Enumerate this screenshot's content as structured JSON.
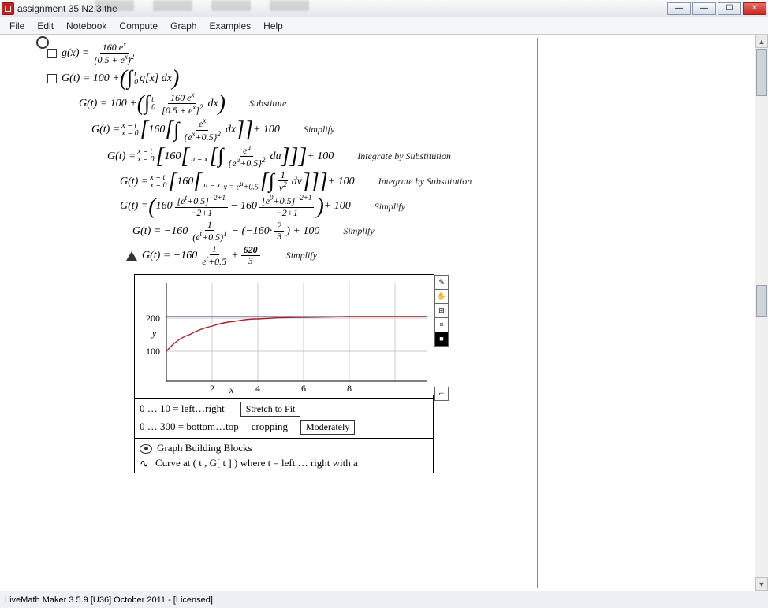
{
  "title": "assignment 35 N2.3.the",
  "menu": {
    "file": "File",
    "edit": "Edit",
    "notebook": "Notebook",
    "compute": "Compute",
    "graph": "Graph",
    "examples": "Examples",
    "help": "Help"
  },
  "eq1": "g(x) = 160 eˣ / (0.5 + eˣ)²",
  "eq2": "G(t) = 100 + ∫₀ᵗ g[x] dx",
  "eq3": "G(t) = 100 + ∫₀ᵗ 160 eˣ / [0.5 + eˣ]² dx",
  "eq4": "G(t) = {x=0..t} 160[ ∫ eˣ/{eˣ+0.5}² dx ] + 100",
  "eq5": "G(t) = {x=0..t} 160[ {u=x} ∫ eᵘ/{eᵘ+0.5}² du ] + 100",
  "eq6": "G(t) = {x=0..t} 160[ {u=x}{v=eᵘ+0.5} ∫ 1/v² dv ] + 100",
  "eq7": "G(t) = (160 [eᵗ+0.5]⁻²⁺¹/(-2+1) − 160 [e⁰+0.5]⁻²⁺¹/(-2+1)) + 100",
  "eq8": "G(t) = −160 · 1/(eᵗ+0.5)¹ − (−160·2/3) + 100",
  "eq9": "G(t) = −160 · 1/(eᵗ+0.5) + 620/3",
  "annot": {
    "sub": "Substitute",
    "simp": "Simplify",
    "ibs": "Integrate by Substitution"
  },
  "graph_range": {
    "xleft": "0 … 10 = left…right",
    "ytop": "0 … 300 = bottom…top",
    "cropping": "cropping"
  },
  "buttons": {
    "stretch": "Stretch to Fit",
    "moderate": "Moderately"
  },
  "blocks": {
    "title": "Graph Building Blocks",
    "curve": "Curve at ( t , G[ t ] )  where  t  =  left  …  right  with a"
  },
  "status": "LiveMath Maker 3.5.9 [U36] October 2011 - [Licensed]",
  "chart_data": {
    "type": "line",
    "title": "",
    "xlabel": "x",
    "ylabel": "y",
    "xlim": [
      0,
      10
    ],
    "ylim": [
      0,
      300
    ],
    "xticks": [
      2,
      4,
      6,
      8
    ],
    "yticks": [
      100,
      200
    ],
    "series": [
      {
        "name": "G(t)",
        "color": "#b02020",
        "x": [
          0,
          0.5,
          1,
          1.5,
          2,
          2.5,
          3,
          4,
          5,
          6,
          7,
          8,
          9,
          10
        ],
        "y": [
          100,
          140,
          164,
          179,
          189,
          195,
          199,
          203,
          205,
          206,
          206,
          206,
          207,
          207
        ]
      },
      {
        "name": "asymptote",
        "color": "#5b54a8",
        "x": [
          0,
          10
        ],
        "y": [
          206.7,
          206.7
        ]
      }
    ]
  }
}
